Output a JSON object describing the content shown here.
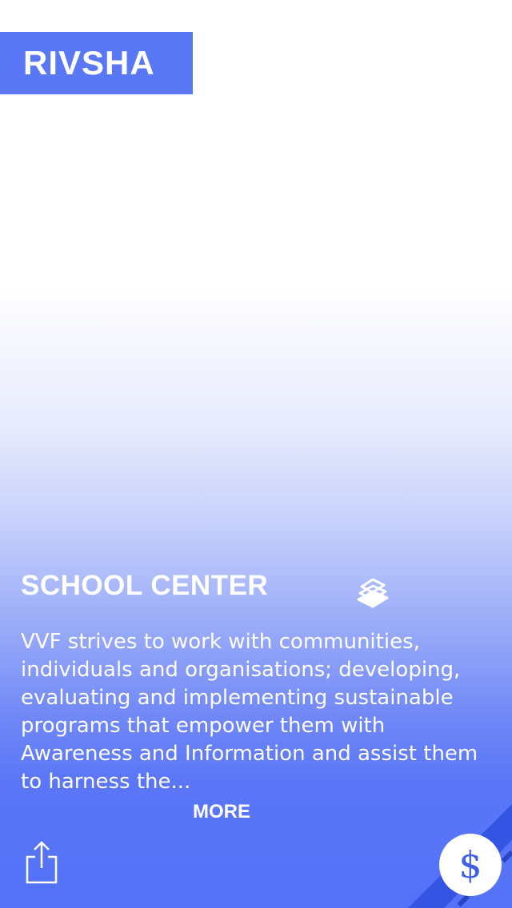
{
  "header": {
    "logo_text": "RIVSHA"
  },
  "card": {
    "title": "SCHOOL CENTER",
    "category_icon": "books-icon",
    "description": "VVF strives to work with communities, individuals and organisations; developing, evaluating and implementing sustainable programs that empower them with Awareness and Information and assist them to harness the...",
    "more_label": "MORE"
  },
  "footer": {
    "share_icon": "share-icon",
    "donate_symbol": "$"
  },
  "colors": {
    "brand": "#5a78f6",
    "background_bottom": "#5472f7",
    "donate_symbol": "#3f5fe6",
    "corner_strip": "#2f4bd6"
  }
}
